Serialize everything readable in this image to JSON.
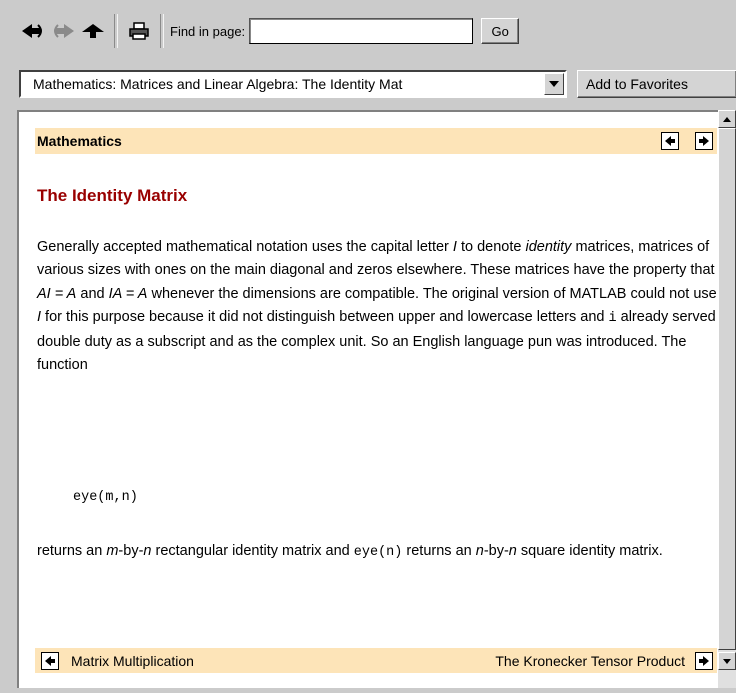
{
  "toolbar": {
    "icons": [
      "back-icon",
      "forward-icon",
      "home-icon",
      "print-icon"
    ],
    "find_label": "Find in page:",
    "find_value": "",
    "go_label": "Go"
  },
  "address": {
    "value": "Mathematics: Matrices and Linear Algebra: The Identity Mat",
    "favorites_label": "Add to Favorites"
  },
  "page": {
    "section": "Mathematics",
    "title": "The Identity Matrix",
    "paragraph1_parts": {
      "a": "Generally accepted mathematical notation uses the capital letter ",
      "b": "I",
      "c": " to denote ",
      "d": "identity",
      "e": " matrices, matrices of various sizes with ones on the main diagonal and zeros elsewhere. These matrices have the property that ",
      "f": "AI = A",
      "g": " and ",
      "h": "IA = A",
      "i": " whenever the dimensions are compatible. The original version of MATLAB could not use ",
      "j": "I",
      "k": " for this purpose because it did not distinguish between upper and lowercase letters and ",
      "l": "i",
      "m": " already served double duty as a subscript and as the complex unit. So an English language pun was introduced. The function"
    },
    "code": "eye(m,n)",
    "paragraph2_parts": {
      "a": "returns an ",
      "b": "m",
      "c": "-by-",
      "d": "n",
      "e": " rectangular identity matrix and ",
      "f": "eye(n)",
      "g": " returns an ",
      "h": "n",
      "i": "-by-",
      "j": "n",
      "k": " square identity matrix."
    },
    "prev_link": "Matrix Multiplication",
    "next_link": "The Kronecker Tensor Product"
  }
}
